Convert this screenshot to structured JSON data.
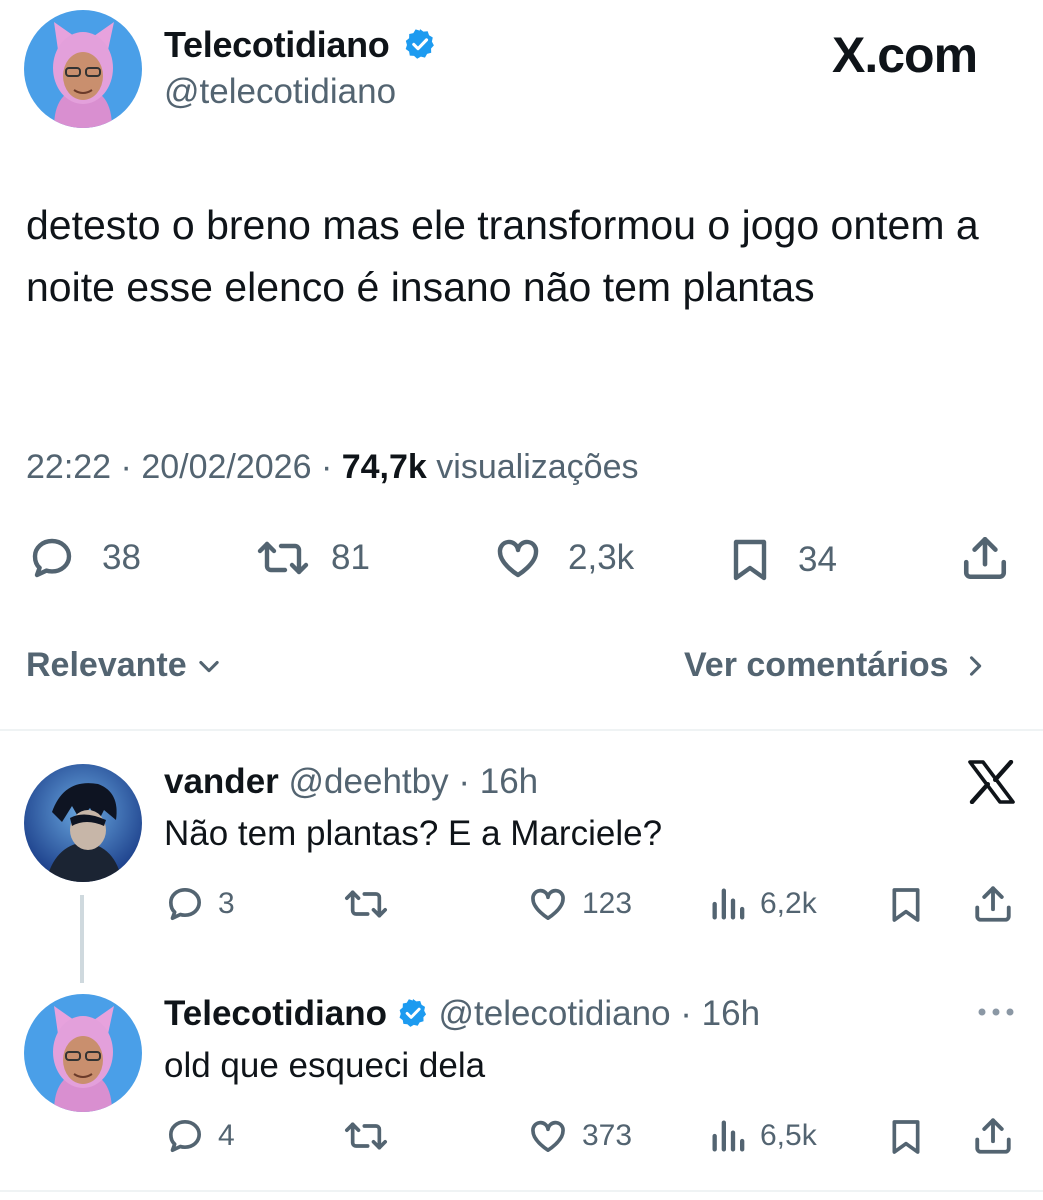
{
  "brand": {
    "label": "X.com"
  },
  "tweet": {
    "author_name": "Telecotidiano",
    "author_handle": "@telecotidiano",
    "text": "detesto o breno mas ele transformou o jogo ontem a noite esse elenco é insano não tem plantas",
    "time": "22:22",
    "date": "20/02/2026",
    "separator": "·",
    "views_count": "74,7k",
    "views_label": "visualizações",
    "replies": "38",
    "retweets": "81",
    "likes": "2,3k",
    "bookmarks": "34"
  },
  "sort": {
    "label": "Relevante",
    "see_comments": "Ver comentários"
  },
  "replies": [
    {
      "name": "vander",
      "handle": "@deehtby",
      "time": "· 16h",
      "text": "Não tem plantas? E a Marciele?",
      "replies": "3",
      "retweets": "",
      "likes": "123",
      "views": "6,2k"
    },
    {
      "name": "Telecotidiano",
      "handle": "@telecotidiano",
      "time": "· 16h",
      "text": "old que esqueci dela",
      "replies": "4",
      "retweets": "",
      "likes": "373",
      "views": "6,5k"
    }
  ],
  "colors": {
    "text": "#0f1419",
    "secondary": "#536471",
    "verified": "#1d9bf0",
    "avatar_bg": "#4a9fe8"
  },
  "icons": [
    "verified-badge-icon",
    "reply-icon",
    "retweet-icon",
    "like-icon",
    "bookmark-icon",
    "share-icon",
    "views-icon",
    "x-logo-icon",
    "more-icon",
    "chevron-down-icon",
    "chevron-right-icon"
  ]
}
